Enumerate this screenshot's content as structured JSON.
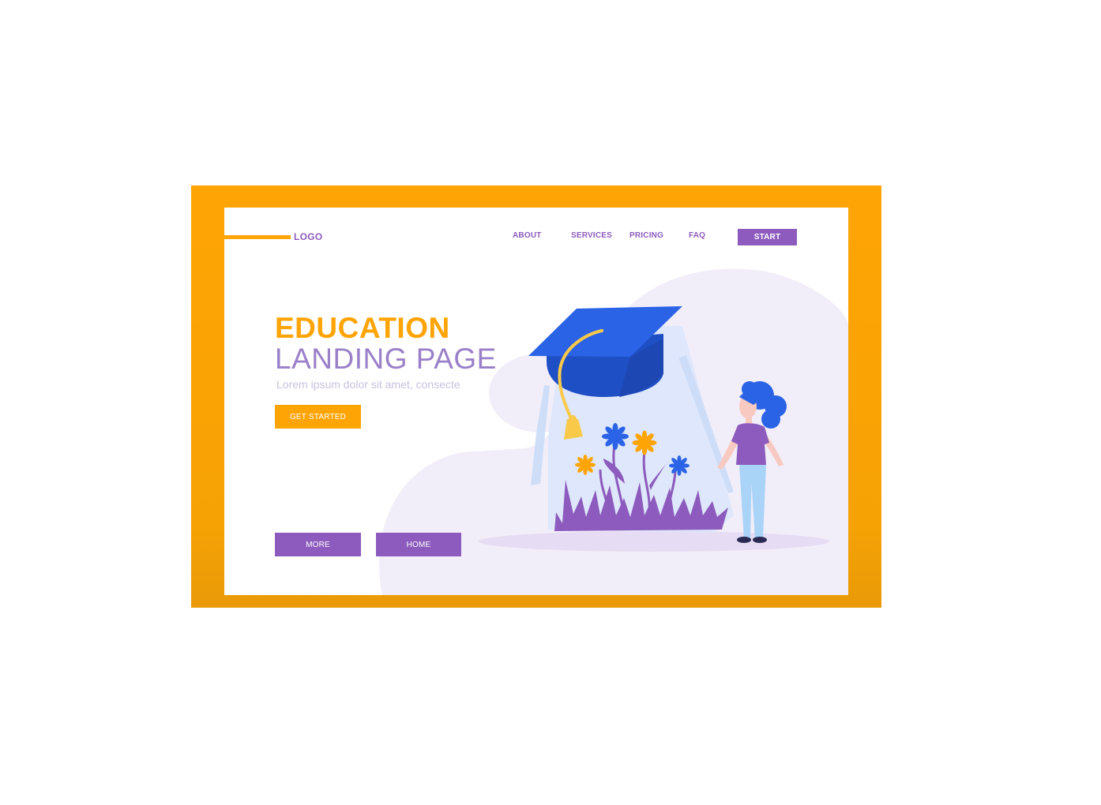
{
  "header": {
    "logo": "LOGO",
    "nav": [
      "ABOUT",
      "SERVICES",
      "PRICING",
      "FAQ"
    ],
    "start_label": "START"
  },
  "hero": {
    "title_line1": "EDUCATION",
    "title_line2": "LANDING PAGE",
    "subtitle": "Lorem ipsum dolor sit amet, consecte",
    "cta_label": "GET STARTED"
  },
  "footer_buttons": {
    "more_label": "MORE",
    "home_label": "HOME"
  },
  "colors": {
    "frame": "#ffa405",
    "accent": "#8c5bbd",
    "cap": "#2b63e6",
    "background_blob": "#f2eef9"
  },
  "illustration": {
    "icons": [
      "graduation-cap-icon",
      "glass-jar-icon",
      "flower-icon",
      "girl-figure-icon",
      "grass-icon"
    ]
  }
}
